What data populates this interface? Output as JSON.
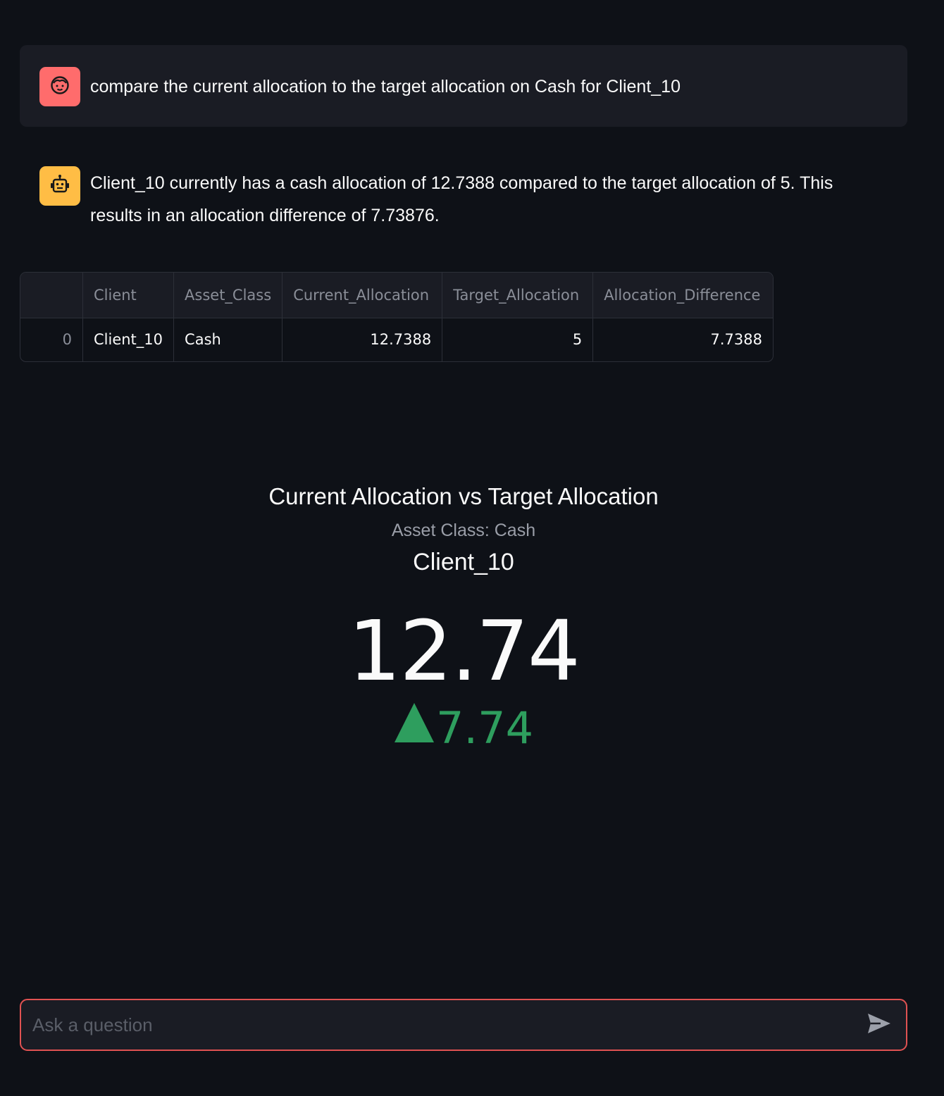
{
  "messages": {
    "user": {
      "text": "compare the current allocation to the target allocation on Cash for Client_10",
      "avatar_icon": "user-face-icon",
      "avatar_color": "#ff6c6c"
    },
    "assistant": {
      "text": "Client_10 currently has a cash allocation of 12.7388 compared to the target allocation of 5. This results in an allocation difference of 7.73876.",
      "avatar_icon": "robot-icon",
      "avatar_color": "#ffbd45"
    }
  },
  "table": {
    "columns": [
      "",
      "Client",
      "Asset_Class",
      "Current_Allocation",
      "Target_Allocation",
      "Allocation_Difference"
    ],
    "rows": [
      [
        "0",
        "Client_10",
        "Cash",
        "12.7388",
        "5",
        "7.7388"
      ]
    ]
  },
  "metric": {
    "title": "Current Allocation vs Target Allocation",
    "subtitle": "Asset Class: Cash",
    "label": "Client_10",
    "value": "12.74",
    "delta": "7.74",
    "delta_direction": "up",
    "delta_color": "#2e9e5e"
  },
  "chat_input": {
    "placeholder": "Ask a question",
    "value": "",
    "send_icon": "send-icon"
  }
}
